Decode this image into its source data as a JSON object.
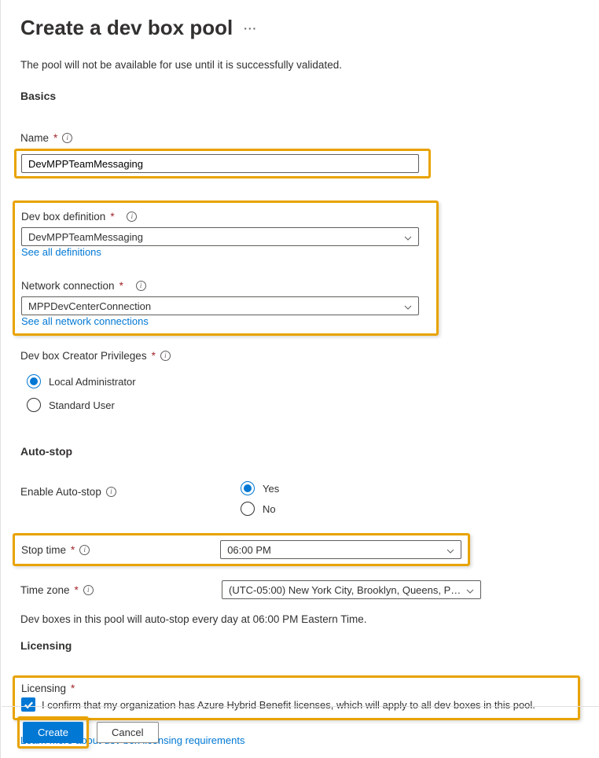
{
  "header": {
    "title": "Create a dev box pool",
    "more": "···"
  },
  "intro": "The pool will not be available for use until it is successfully validated.",
  "sections": {
    "basics": "Basics",
    "autostop": "Auto-stop",
    "licensing": "Licensing"
  },
  "fields": {
    "name": {
      "label": "Name",
      "value": "DevMPPTeamMessaging"
    },
    "definition": {
      "label": "Dev box definition",
      "value": "DevMPPTeamMessaging",
      "link": "See all definitions"
    },
    "network": {
      "label": "Network connection",
      "value": "MPPDevCenterConnection",
      "link": "See all network connections"
    },
    "privileges": {
      "label": "Dev box Creator Privileges",
      "options": {
        "local": "Local Administrator",
        "standard": "Standard User"
      }
    },
    "enableAutoStop": {
      "label": "Enable Auto-stop",
      "options": {
        "yes": "Yes",
        "no": "No"
      }
    },
    "stopTime": {
      "label": "Stop time",
      "value": "06:00 PM"
    },
    "timeZone": {
      "label": "Time zone",
      "value": "(UTC-05:00) New York City, Brooklyn, Queens, P…"
    },
    "autoStopNote": "Dev boxes in this pool will auto-stop every day at 06:00 PM Eastern Time.",
    "licensing": {
      "label": "Licensing",
      "confirm": "I confirm that my organization has Azure Hybrid Benefit licenses, which will apply to all dev boxes in this pool.",
      "link": "Learn more about dev box licensing requirements"
    }
  },
  "footer": {
    "create": "Create",
    "cancel": "Cancel"
  }
}
